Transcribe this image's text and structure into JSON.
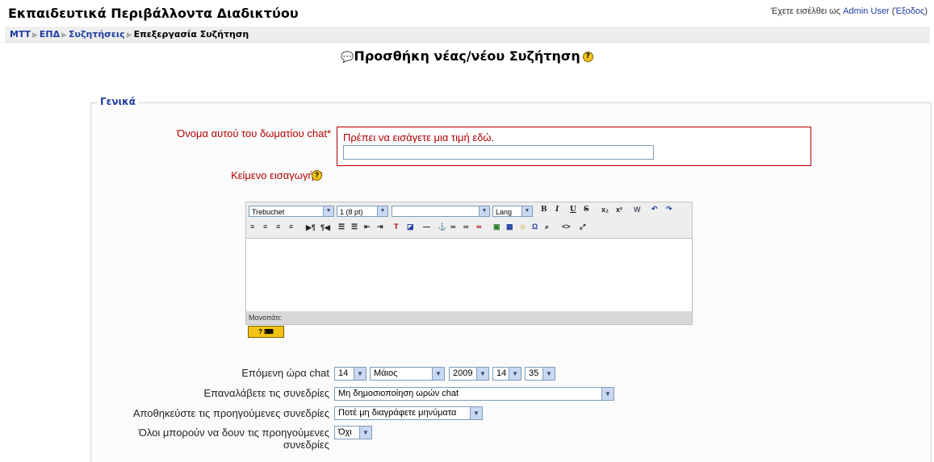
{
  "header": {
    "site_title": "Εκπαιδευτικά Περιβάλλοντα Διαδικτύου",
    "login_prefix": "Έχετε εισέλθει ως",
    "login_user": "Admin User",
    "logout_open": "(",
    "logout_label": "Έξοδος",
    "logout_close": ")"
  },
  "breadcrumb": {
    "items": [
      "ΜΤΤ",
      "ΕΠΔ",
      "Συζητήσεις"
    ],
    "current": "Επεξεργασία Συζήτηση"
  },
  "page": {
    "heading": "Προσθήκη νέας/νέου Συζήτηση"
  },
  "form": {
    "section": "Γενικά",
    "name_label": "Όνομα αυτού του δωματίου chat*",
    "name_error": "Πρέπει να εισάγετε μια τιμή εδώ.",
    "name_value": "",
    "intro_label": "Κείμενο εισαγωγής*",
    "next_chat_label": "Επόμενη ώρα chat",
    "day": "14",
    "month": "Μάιος",
    "year": "2009",
    "hour": "14",
    "minute": "35",
    "repeat_label": "Επαναλάβετε τις συνεδρίες",
    "repeat_value": "Μη δημοσιοποίηση ωρών chat",
    "save_label": "Αποθηκεύστε τις προηγούμενες συνεδρίες",
    "save_value": "Ποτέ μη διαγράφετε μηνύματα",
    "view_label_line1": "Όλοι μπορούν να δουν τις προηγούμενες",
    "view_label_line2": "συνεδρίες",
    "view_value": "Όχι"
  },
  "editor": {
    "font": "Trebuchet",
    "size": "1 (8 pt)",
    "lang": "Lang",
    "path_label": "Μονοπάτι:"
  },
  "colors": {
    "link": "#1e3ca0",
    "error": "#b00000"
  }
}
